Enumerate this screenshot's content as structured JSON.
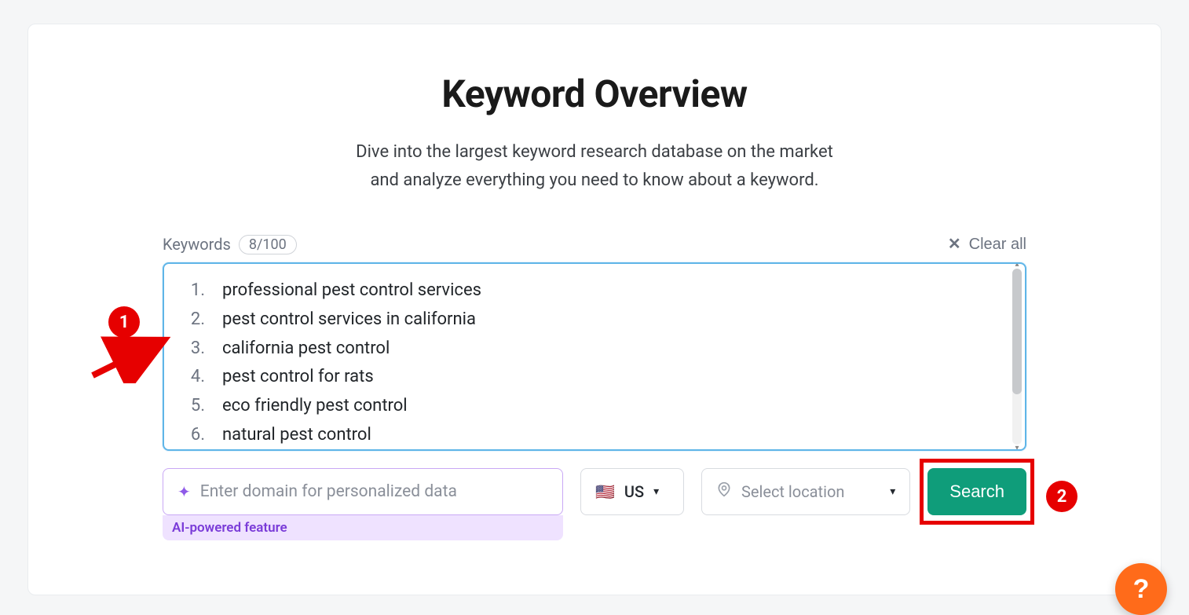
{
  "title": "Keyword Overview",
  "subtitle_line1": "Dive into the largest keyword research database on the market",
  "subtitle_line2": "and analyze everything you need to know about a keyword.",
  "keywords_label": "Keywords",
  "keywords_count": "8/100",
  "clear_all_label": "Clear all",
  "keywords": [
    "professional pest control services",
    "pest control services in california",
    "california pest control",
    "pest control for rats",
    "eco friendly pest control",
    "natural pest control"
  ],
  "domain_placeholder": "Enter domain for personalized data",
  "ai_feature_label": "AI-powered feature",
  "country_code": "US",
  "country_flag": "🇺🇸",
  "location_placeholder": "Select location",
  "search_label": "Search",
  "annotations": {
    "one": "1",
    "two": "2"
  },
  "help_label": "?"
}
